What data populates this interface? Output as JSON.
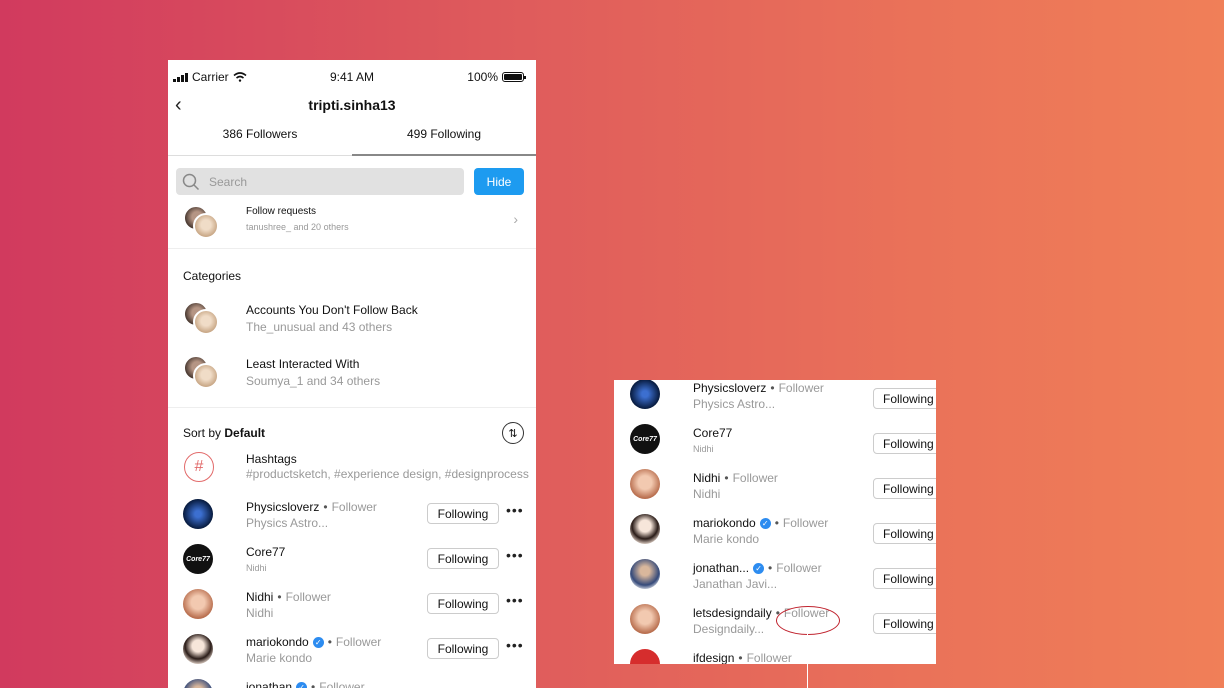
{
  "status_bar": {
    "carrier": "Carrier",
    "time": "9:41 AM",
    "battery": "100%"
  },
  "header": {
    "back_icon": "‹",
    "title": "tripti.sinha13"
  },
  "tabs": [
    {
      "label": "386 Followers",
      "active": false
    },
    {
      "label": "499 Following",
      "active": true
    }
  ],
  "search": {
    "placeholder": "Search",
    "hide_label": "Hide"
  },
  "follow_requests": {
    "title": "Follow requests",
    "subtitle": "tanushree_ and 20 others"
  },
  "categories": {
    "heading": "Categories",
    "items": [
      {
        "title": "Accounts You Don't Follow Back",
        "subtitle": "The_unusual and 43 others"
      },
      {
        "title": "Least Interacted With",
        "subtitle": "Soumya_1 and 34 others"
      }
    ]
  },
  "sort": {
    "prefix": "Sort by ",
    "value": "Default"
  },
  "hashtags": {
    "icon": "#",
    "title": "Hashtags",
    "subtitle": "#productsketch, #experience design, #designprocess"
  },
  "list": [
    {
      "name": "Physicsloverz",
      "dot": "•",
      "tag": "Follower",
      "sub": "Physics Astro...",
      "button": "Following",
      "more": "•••"
    },
    {
      "name": "Core77",
      "dot": "",
      "tag": "",
      "sub": "Nidhi",
      "button": "Following",
      "more": "•••",
      "avatar_text": "Core77"
    },
    {
      "name": "Nidhi",
      "dot": "•",
      "tag": "Follower",
      "sub": "Nidhi",
      "button": "Following",
      "more": "•••"
    },
    {
      "name": "mariokondo",
      "dot": "•",
      "tag": "Follower",
      "sub": "Marie kondo",
      "button": "Following",
      "more": "•••",
      "verified": true
    },
    {
      "name": "jonathan",
      "dot": "•",
      "tag": "Follower",
      "sub": "",
      "button": "",
      "more": "",
      "verified": true
    }
  ],
  "zoom_list": [
    {
      "name": "Physicsloverz",
      "dot": "•",
      "tag": "Follower",
      "sub": "Physics Astro...",
      "button": "Following"
    },
    {
      "name": "Core77",
      "dot": "",
      "tag": "",
      "sub": "Nidhi",
      "button": "Following",
      "avatar_text": "Core77"
    },
    {
      "name": "Nidhi",
      "dot": "•",
      "tag": "Follower",
      "sub": "Nidhi",
      "button": "Following"
    },
    {
      "name": "mariokondo",
      "dot": "•",
      "tag": "Follower",
      "sub": "Marie kondo",
      "button": "Following",
      "verified": true
    },
    {
      "name": "jonathan...",
      "dot": "•",
      "tag": "Follower",
      "sub": "Janathan Javi...",
      "button": "Following",
      "verified": true
    },
    {
      "name": "letsdesigndaily",
      "dot": "•",
      "tag": "Follower",
      "sub": "Designdaily...",
      "button": "Following"
    },
    {
      "name": "ifdesign",
      "dot": "•",
      "tag": "Follower",
      "sub": "",
      "button": ""
    }
  ],
  "icons": {
    "search": "search-icon",
    "chevron": "chevron-right-icon",
    "sort": "sort-icon",
    "verified": "verified-icon"
  },
  "colors": {
    "accent": "#1d9bf0",
    "highlight": "#c0232e",
    "bg_start": "#d13a5e",
    "bg_end": "#f07f58"
  }
}
